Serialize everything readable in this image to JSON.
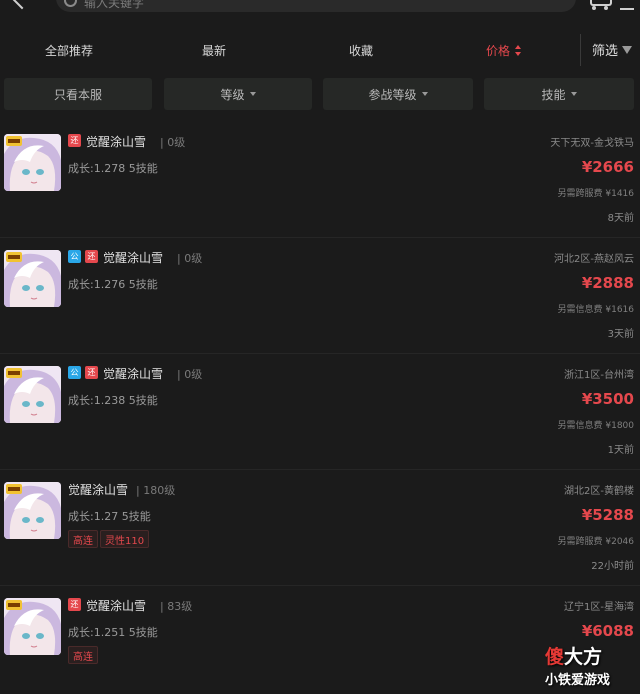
{
  "search": {
    "placeholder": "输入关键字"
  },
  "tabs": [
    {
      "label": "全部推荐",
      "active": false
    },
    {
      "label": "最新",
      "active": false
    },
    {
      "label": "收藏",
      "active": false
    },
    {
      "label": "价格",
      "active": true
    }
  ],
  "filter_label": "筛选",
  "filters": [
    "只看本服",
    "等级",
    "参战等级",
    "技能"
  ],
  "items": [
    {
      "name": "觉醒涂山雪",
      "level": "0级",
      "growth": "成长:1.278 5技能",
      "server": "天下无双-金戈铁马",
      "price": "¥2666",
      "fee": "另需跨服费 ¥1416",
      "time": "8天前",
      "badges": [
        "还"
      ],
      "tags": []
    },
    {
      "name": "觉醒涂山雪",
      "level": "0级",
      "growth": "成长:1.276 5技能",
      "server": "河北2区-燕赵风云",
      "price": "¥2888",
      "fee": "另需信息费 ¥1616",
      "time": "3天前",
      "badges": [
        "公",
        "还"
      ],
      "tags": []
    },
    {
      "name": "觉醒涂山雪",
      "level": "0级",
      "growth": "成长:1.238 5技能",
      "server": "浙江1区-台州湾",
      "price": "¥3500",
      "fee": "另需信息费 ¥1800",
      "time": "1天前",
      "badges": [
        "公",
        "还"
      ],
      "tags": []
    },
    {
      "name": "觉醒涂山雪",
      "level": "180级",
      "growth": "成长:1.27 5技能",
      "server": "湖北2区-黄鹤楼",
      "price": "¥5288",
      "fee": "另需跨服费 ¥2046",
      "time": "22小时前",
      "badges": [],
      "tags": [
        "高连",
        "灵性110"
      ]
    },
    {
      "name": "觉醒涂山雪",
      "level": "83级",
      "growth": "成长:1.251 5技能",
      "server": "辽宁1区-星海湾",
      "price": "¥6088",
      "fee": "",
      "time": "",
      "badges": [
        "还"
      ],
      "tags": [
        "高连"
      ]
    }
  ],
  "watermark": {
    "line1_a": "傻",
    "line1_b": "大方",
    "line2": "小铁爱游戏"
  },
  "colors": {
    "accent": "#e5484d",
    "badge_gong": "#2aa7e8",
    "badge_huan": "#e5484d",
    "bg": "#1b1b1b"
  }
}
